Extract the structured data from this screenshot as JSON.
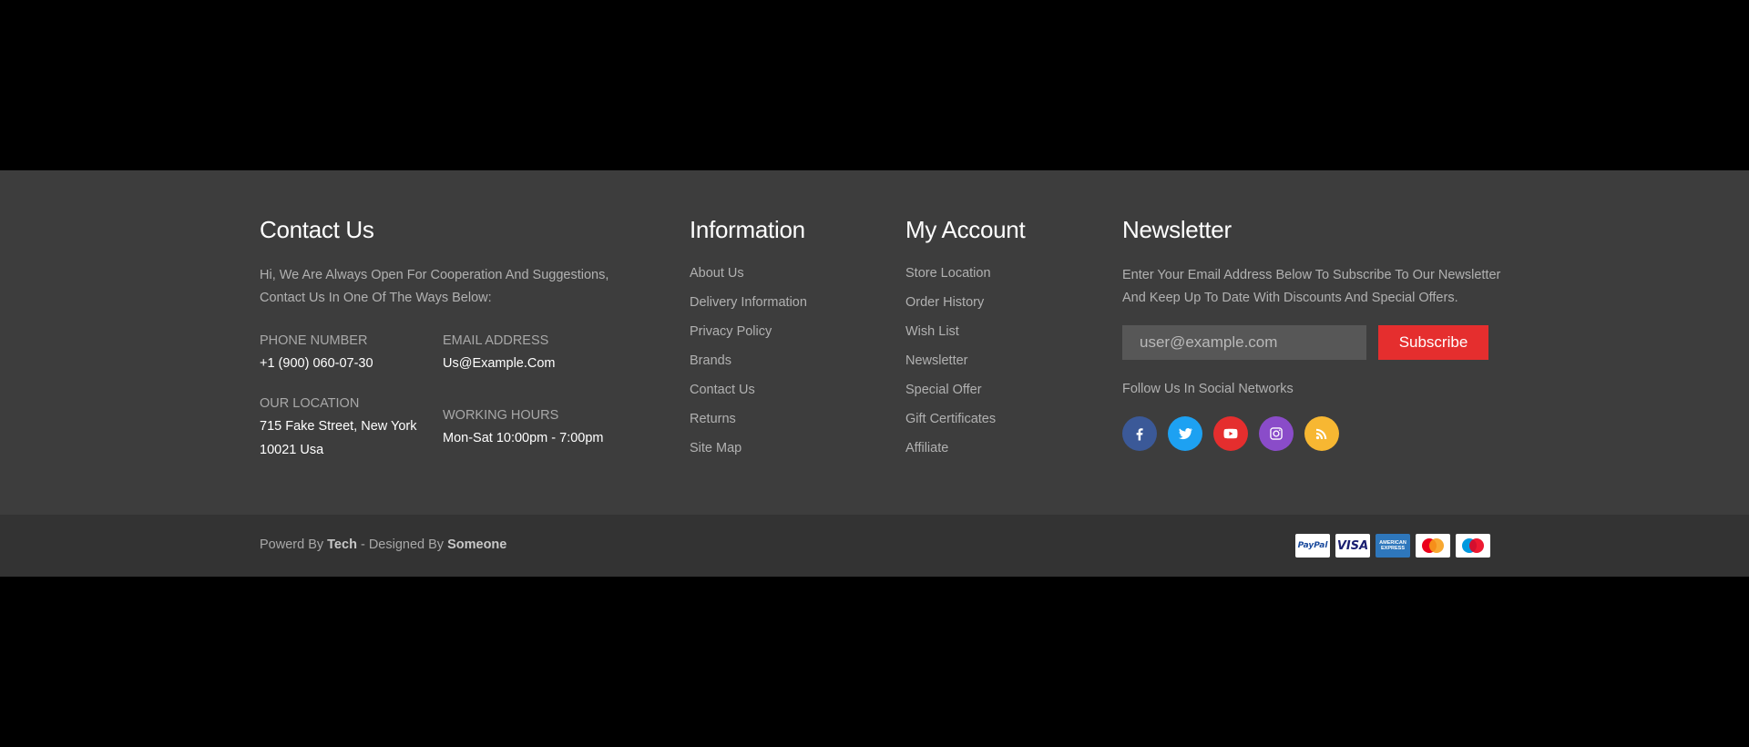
{
  "colors": {
    "page_background": "#000000",
    "footer_background": "#3d3d3d",
    "bottom_bar_background": "#333333",
    "accent": "#e52e2e",
    "facebook": "#3b5998",
    "twitter": "#1da1f2",
    "youtube": "#e52e2e",
    "instagram": "#8a4cc9",
    "rss": "#f7b732"
  },
  "contact": {
    "title": "Contact Us",
    "intro_line1": "Hi, We Are Always Open For Cooperation And Suggestions,",
    "intro_line2": "Contact Us In One Of The Ways Below:",
    "phone_label": "PHONE NUMBER",
    "phone_value": "+1 (900) 060-07-30",
    "email_label": "EMAIL ADDRESS",
    "email_value": "Us@Example.Com",
    "location_label": "OUR LOCATION",
    "location_line1": "715 Fake Street, New York",
    "location_line2": "10021 Usa",
    "hours_label": "WORKING HOURS",
    "hours_value": "Mon-Sat 10:00pm - 7:00pm"
  },
  "information": {
    "title": "Information",
    "links": [
      "About Us",
      "Delivery Information",
      "Privacy Policy",
      "Brands",
      "Contact Us",
      "Returns",
      "Site Map"
    ]
  },
  "account": {
    "title": "My Account",
    "links": [
      "Store Location",
      "Order History",
      "Wish List",
      "Newsletter",
      "Special Offer",
      "Gift Certificates",
      "Affiliate"
    ]
  },
  "newsletter": {
    "title": "Newsletter",
    "desc_line1": "Enter Your Email Address Below To Subscribe To Our Newsletter",
    "desc_line2": "And Keep Up To Date With Discounts And Special Offers.",
    "email_placeholder": "user@example.com",
    "subscribe_label": "Subscribe",
    "follow_text": "Follow Us In Social Networks",
    "social_icons": [
      "facebook-icon",
      "twitter-icon",
      "youtube-icon",
      "instagram-icon",
      "rss-icon"
    ]
  },
  "bottom": {
    "powered_prefix": "Powerd By",
    "powered_brand": "Tech",
    "designed_prefix": "- Designed By",
    "designer": "Someone",
    "payment_icons": [
      "paypal-icon",
      "visa-icon",
      "american-express-icon",
      "mastercard-icon",
      "maestro-icon"
    ],
    "paypal_text": "PayPal",
    "visa_text": "VISA",
    "amex_text_line1": "AMERICAN",
    "amex_text_line2": "EXPRESS"
  }
}
